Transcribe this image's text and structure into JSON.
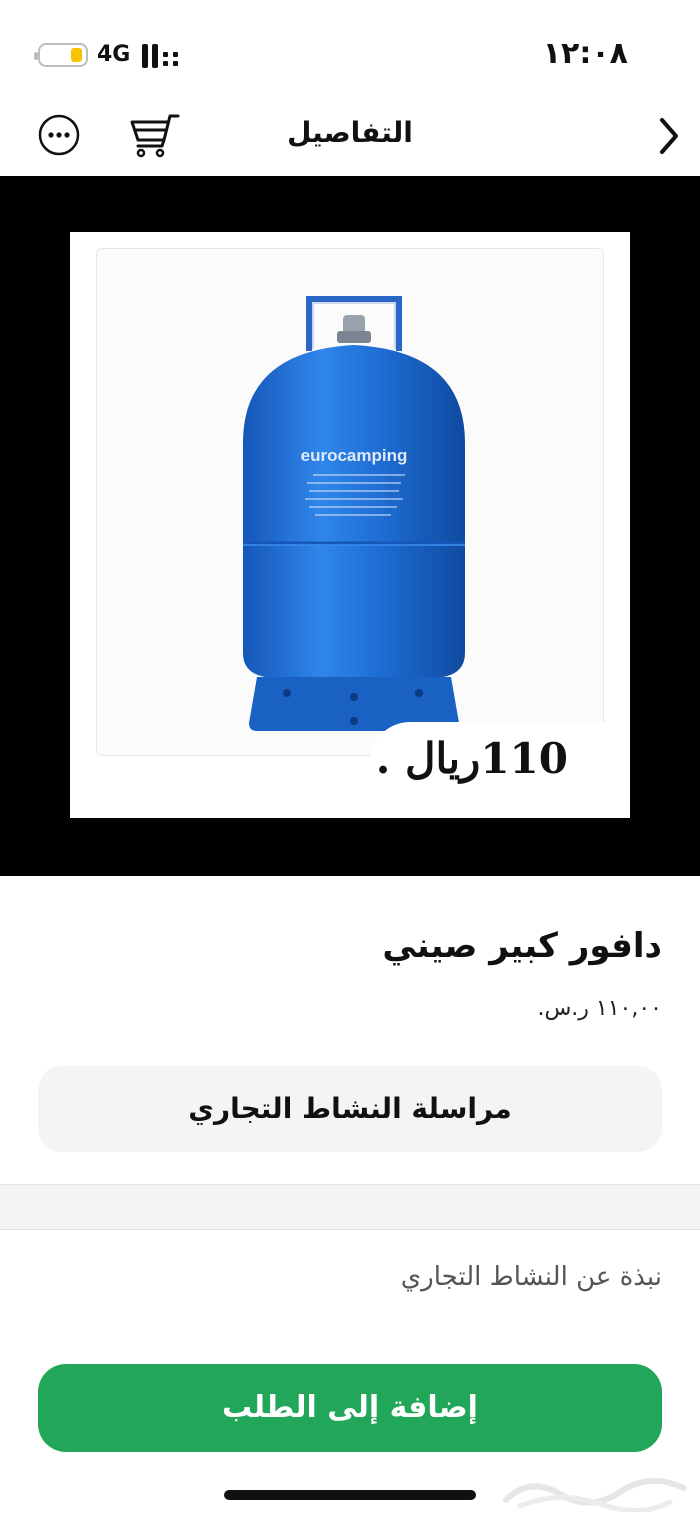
{
  "status_bar": {
    "network": "4G",
    "time": "١٢:٠٨"
  },
  "nav": {
    "title": "التفاصيل"
  },
  "image": {
    "cylinder_brand": "eurocamping",
    "overlay_price": "110ريال ."
  },
  "product": {
    "title": "دافور كبير صيني",
    "price": "١١٠,٠٠ ر.س.",
    "contact_button": "مراسلة النشاط التجاري",
    "about_label": "نبذة عن النشاط التجاري",
    "add_button": "إضافة إلى الطلب"
  },
  "colors": {
    "accent_green": "#22a65a",
    "battery_yellow": "#f5c400",
    "cylinder_blue": "#1f6fd6"
  },
  "icons": [
    "back-chevron-icon",
    "cart-icon",
    "more-icon",
    "battery-icon",
    "signal-icon"
  ]
}
